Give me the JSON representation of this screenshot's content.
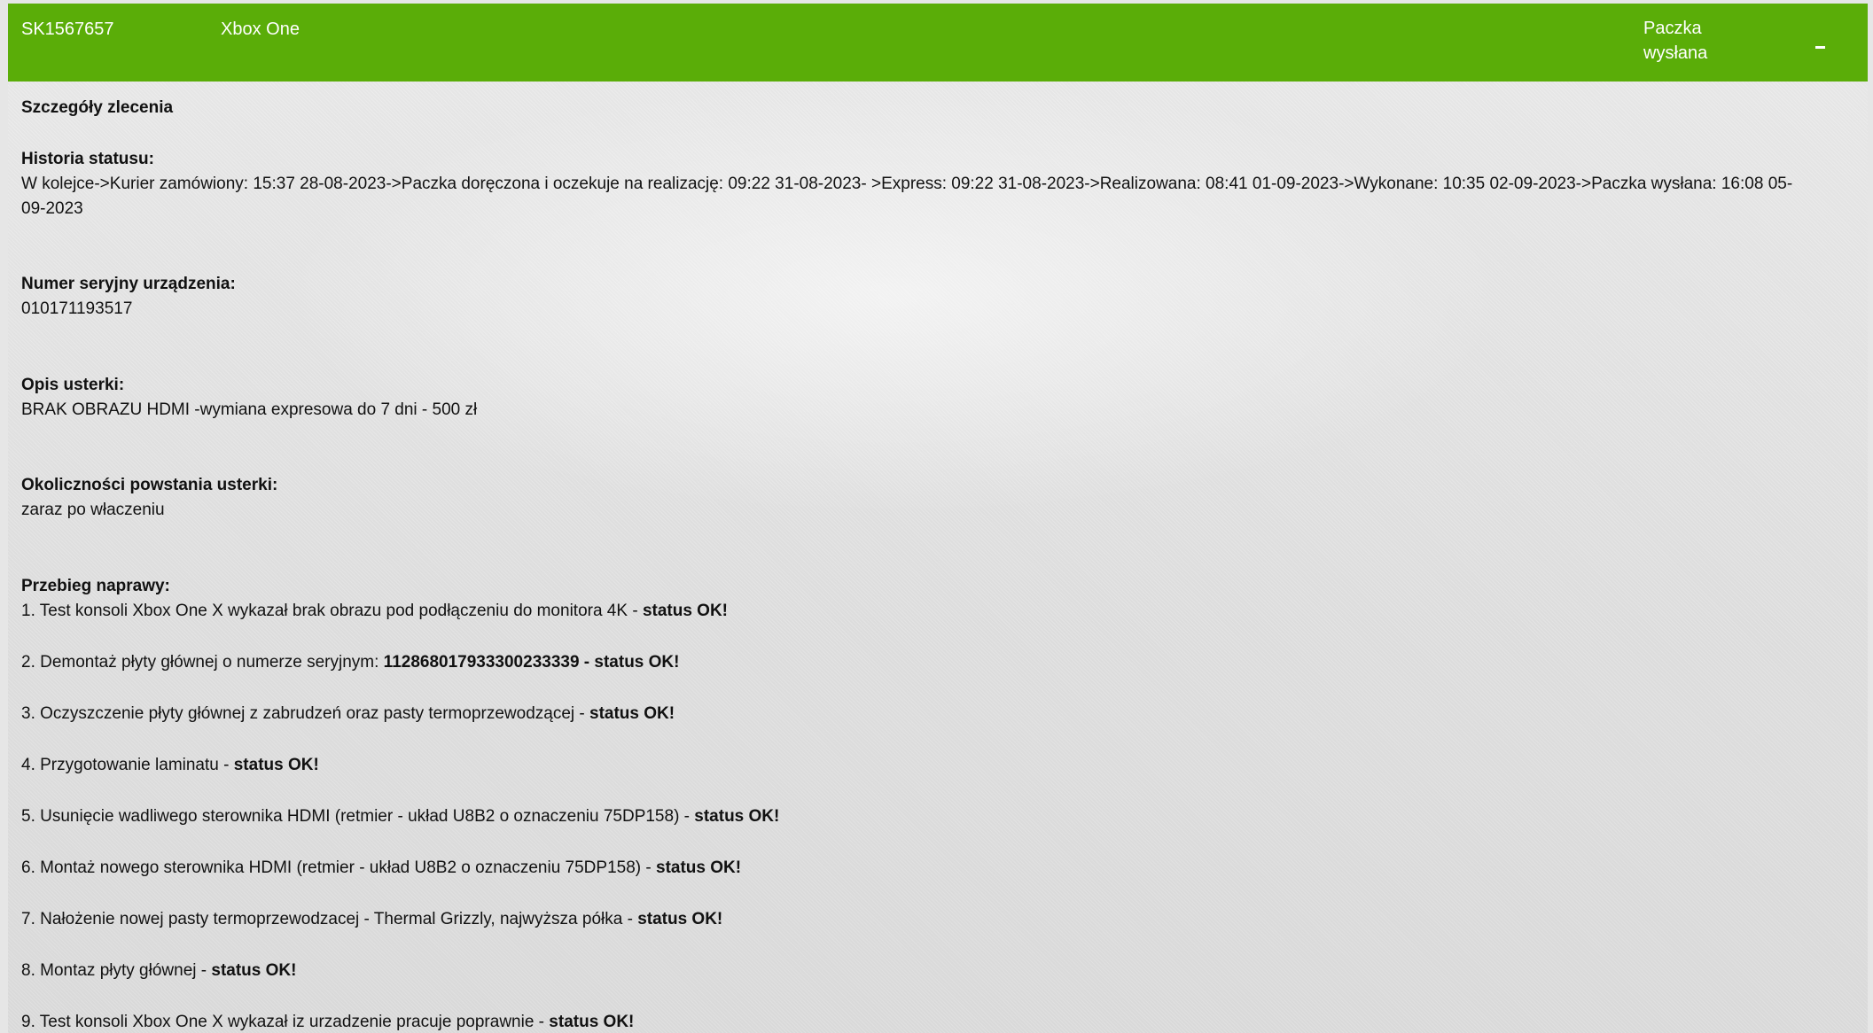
{
  "header": {
    "order_id": "SK1567657",
    "device": "Xbox One",
    "status_line1": "Paczka",
    "status_line2": "wysłana",
    "collapse_symbol": "-"
  },
  "details": {
    "title": "Szczegóły zlecenia",
    "history_label": "Historia statusu:",
    "history_line1": "W kolejce->Kurier zamówiony: 15:37 28-08-2023->Paczka doręczona i oczekuje na realizację: 09:22 31-08-2023- >Express: 09:22 31-08-2023->Realizowana: 08:41 01-09-2023->Wykonane: 10:35 02-09-2023->Paczka wysłana: 16:08 05-",
    "history_line2": "09-2023",
    "serial_label": "Numer seryjny urządzenia:",
    "serial_value": "010171193517",
    "fault_label": "Opis usterki:",
    "fault_value": "BRAK OBRAZU HDMI -wymiana expresowa do 7 dni - 500 zł",
    "circumstances_label": "Okoliczności powstania usterki:",
    "circumstances_value": "zaraz po właczeniu",
    "repair_label": "Przebieg naprawy:"
  },
  "repair_steps": [
    {
      "text": "1. Test konsoli Xbox One X wykazał brak obrazu pod podłączeniu do monitora 4K - ",
      "bold": "status OK!"
    },
    {
      "text": "2. Demontaż płyty głównej o numerze seryjnym:  ",
      "bold": "112868017933300233339 - status OK!"
    },
    {
      "text": "3. Oczyszczenie płyty głównej z zabrudzeń oraz pasty termoprzewodzącej - ",
      "bold": "status OK!"
    },
    {
      "text": "4. Przygotowanie laminatu - ",
      "bold": "status OK!"
    },
    {
      "text": "5. Usunięcie wadliwego sterownika HDMI (retmier - układ U8B2 o oznaczeniu 75DP158) - ",
      "bold": "status OK!"
    },
    {
      "text": "6. Montaż nowego sterownika HDMI (retmier - układ U8B2 o oznaczeniu 75DP158) - ",
      "bold": "status OK!"
    },
    {
      "text": "7. Nałożenie nowej pasty termoprzewodzacej - Thermal Grizzly, najwyższa półka - ",
      "bold": "status OK!"
    },
    {
      "text": "8. Montaz płyty głównej - ",
      "bold": "status OK!"
    },
    {
      "text": "9. Test konsoli Xbox One X wykazał iz urzadzenie pracuje poprawnie - ",
      "bold": "status OK!"
    }
  ],
  "colors": {
    "header_green": "#5aad08",
    "header_text": "#ffffff",
    "body_text": "#111111",
    "background": "#e6e6e6"
  }
}
